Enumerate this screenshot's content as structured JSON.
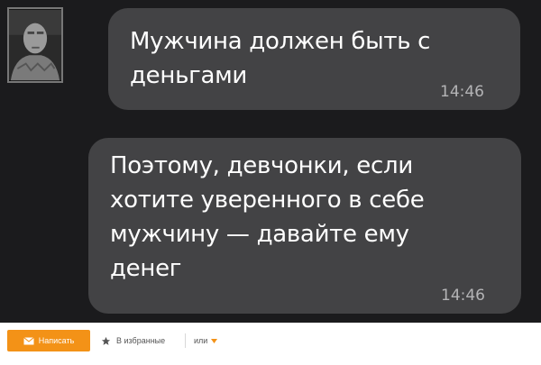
{
  "messages": [
    {
      "text": "Мужчина должен быть с\nденьгами",
      "time": "14:46"
    },
    {
      "text": "Поэтому, девчонки, если\nхотите уверенного в себе\nмужчину — давайте ему\nденег",
      "time": "14:46"
    }
  ],
  "footer": {
    "write_label": "Написать",
    "favorites_label": "В избранные",
    "more_label": "или"
  },
  "colors": {
    "chat_background": "#1b1b1d",
    "bubble": "#434345",
    "accent": "#f39217"
  },
  "icons": {
    "write": "envelope-icon",
    "favorites": "star-icon",
    "more": "caret-down-icon"
  }
}
